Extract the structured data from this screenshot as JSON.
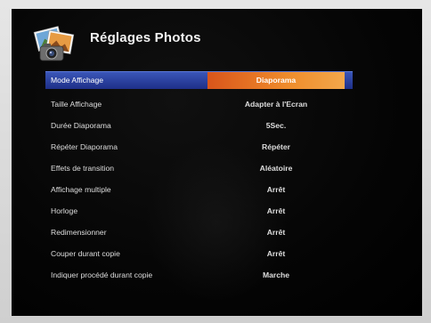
{
  "header": {
    "title": "Réglages Photos",
    "icon": "photo-settings-icon"
  },
  "menu": {
    "items": [
      {
        "label": "Mode Affichage",
        "value": "Diaporama",
        "selected": true
      },
      {
        "label": "Taille Affichage",
        "value": "Adapter à l'Ecran"
      },
      {
        "label": "Durée Diaporama",
        "value": "5Sec."
      },
      {
        "label": "Répéter Diaporama",
        "value": "Répéter"
      },
      {
        "label": "Effets de transition",
        "value": "Aléatoire"
      },
      {
        "label": "Affichage multiple",
        "value": "Arrêt"
      },
      {
        "label": "Horloge",
        "value": "Arrêt"
      },
      {
        "label": "Redimensionner",
        "value": "Arrêt"
      },
      {
        "label": "Couper durant copie",
        "value": "Arrêt"
      },
      {
        "label": "Indiquer procédé durant copie",
        "value": "Marche"
      }
    ]
  },
  "colors": {
    "selection_bar": "#2a3f9e",
    "selection_value": "#e8782a",
    "background": "#000000",
    "text": "#dedede"
  }
}
